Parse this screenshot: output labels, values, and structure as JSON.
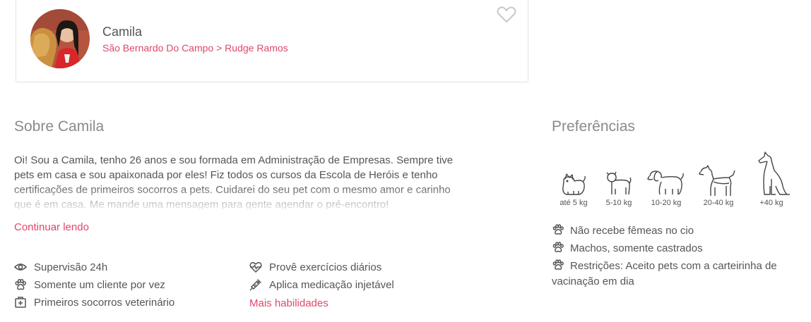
{
  "sitter": {
    "name": "Camila",
    "city": "São Bernardo Do Campo",
    "separator": ">",
    "neighborhood": "Rudge Ramos"
  },
  "about": {
    "title": "Sobre Camila",
    "text": "Oi! Sou a Camila, tenho 26 anos e sou formada em Administração de Empresas. Sempre tive pets em casa e sou apaixonada por eles! Fiz todos os cursos da Escola de Heróis e tenho certificações de primeiros socorros a pets. Cuidarei do seu pet com o mesmo amor e carinho que é em casa. Me mande uma mensagem para gente agendar o pré-encontro!",
    "read_more": "Continuar lendo"
  },
  "skills": {
    "left": [
      {
        "label": "Supervisão 24h",
        "icon": "eye-icon"
      },
      {
        "label": "Somente um cliente por vez",
        "icon": "paw-icon"
      },
      {
        "label": "Primeiros socorros veterinário",
        "icon": "first-aid-icon"
      }
    ],
    "right": [
      {
        "label": "Provê exercícios diários",
        "icon": "heartbeat-icon"
      },
      {
        "label": "Aplica medicação injetável",
        "icon": "syringe-icon"
      }
    ],
    "more": "Mais habilidades"
  },
  "preferences": {
    "title": "Preferências",
    "sizes": [
      "até 5 kg",
      "5-10 kg",
      "10-20 kg",
      "20-40 kg",
      "+40 kg"
    ],
    "items": [
      "Não recebe fêmeas no cio",
      "Machos, somente castrados",
      "Restrições: Aceito pets com a carteirinha de vacinação em dia"
    ]
  },
  "colors": {
    "accent": "#e0476b",
    "text": "#555555",
    "muted": "#8a8a8a"
  }
}
